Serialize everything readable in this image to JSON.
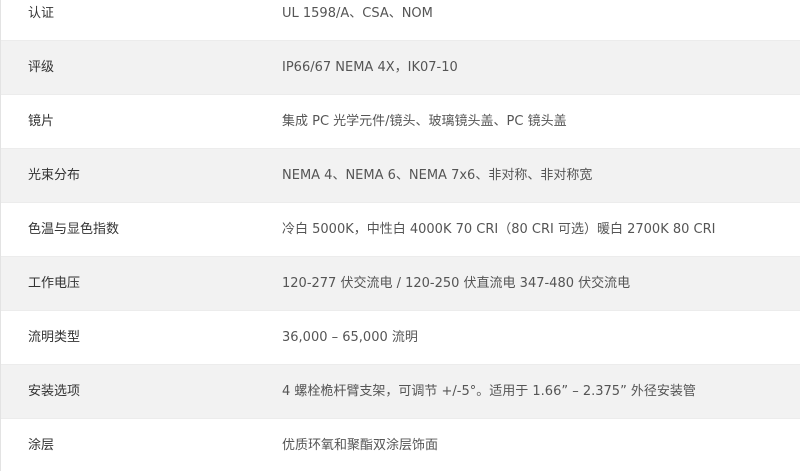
{
  "spec_rows": [
    {
      "label": "认证",
      "value": "UL 1598/A、CSA、NOM"
    },
    {
      "label": "评级",
      "value": "IP66/67 NEMA 4X，IK07-10"
    },
    {
      "label": "镜片",
      "value": "集成 PC 光学元件/镜头、玻璃镜头盖、PC 镜头盖"
    },
    {
      "label": "光束分布",
      "value": "NEMA 4、NEMA 6、NEMA 7x6、非对称、非对称宽"
    },
    {
      "label": "色温与显色指数",
      "value": "冷白 5000K，中性白 4000K 70 CRI（80 CRI 可选）暖白 2700K 80 CRI"
    },
    {
      "label": "工作电压",
      "value": "120-277 伏交流电 / 120-250 伏直流电 347-480 伏交流电"
    },
    {
      "label": "流明类型",
      "value": "36,000 – 65,000 流明"
    },
    {
      "label": "安装选项",
      "value": "4 螺栓桅杆臂支架，可调节 +/-5°。适用于 1.66” – 2.375” 外径安装管"
    },
    {
      "label": "涂层",
      "value": "优质环氧和聚酯双涂层饰面"
    }
  ]
}
